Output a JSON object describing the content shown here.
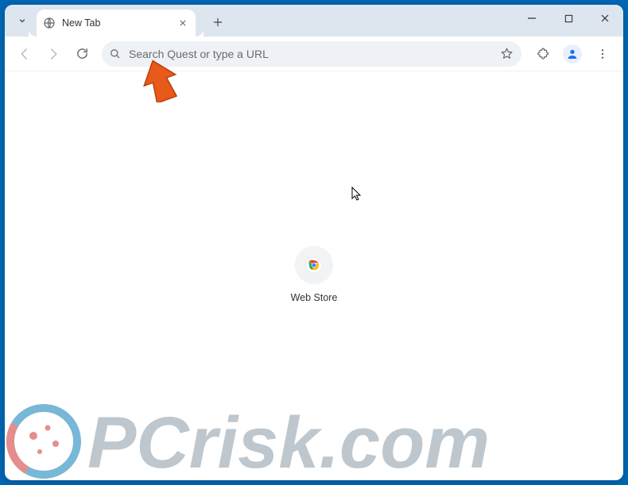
{
  "tab": {
    "title": "New Tab"
  },
  "omnibox": {
    "placeholder": "Search Quest or type a URL"
  },
  "shortcuts": {
    "webstore": {
      "label": "Web Store"
    }
  },
  "watermark": {
    "text": "PCrisk.com"
  }
}
